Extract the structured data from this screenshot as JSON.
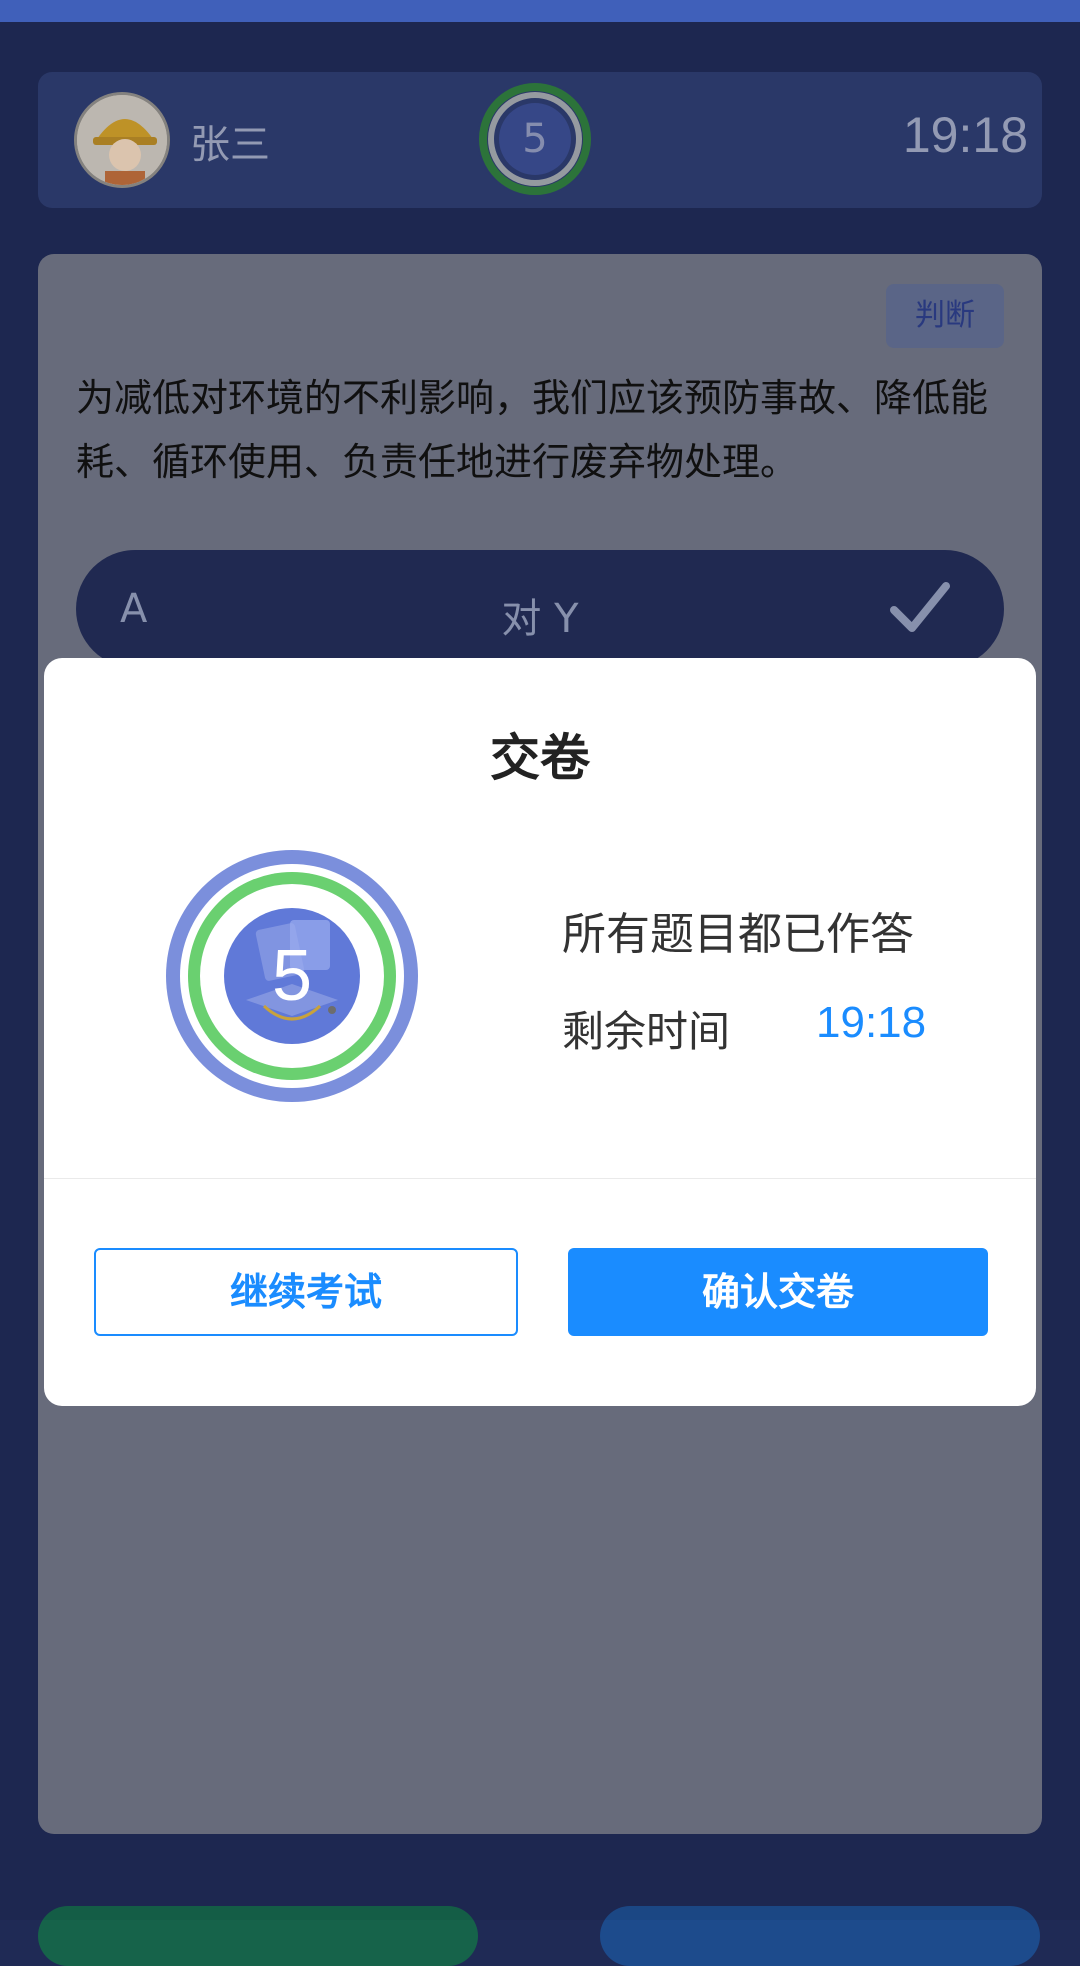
{
  "header": {
    "user_name": "张三",
    "badge_number": "5",
    "timer": "19:18"
  },
  "question": {
    "type_tag": "判断",
    "text": "为减低对环境的不利影响，我们应该预防事故、降低能耗、循环使用、负责任地进行废弃物处理。",
    "options": [
      {
        "letter": "A",
        "text": "对 Y",
        "icon": "check-icon"
      }
    ]
  },
  "modal": {
    "title": "交卷",
    "badge_number": "5",
    "status": "所有题目都已作答",
    "remaining_label": "剩余时间",
    "remaining_value": "19:18",
    "continue_label": "继续考试",
    "confirm_label": "确认交卷"
  },
  "colors": {
    "accent": "#1a8cff",
    "background": "#1f2a55",
    "ring_green": "#6ad070",
    "ring_blue": "#7b8fdc"
  }
}
